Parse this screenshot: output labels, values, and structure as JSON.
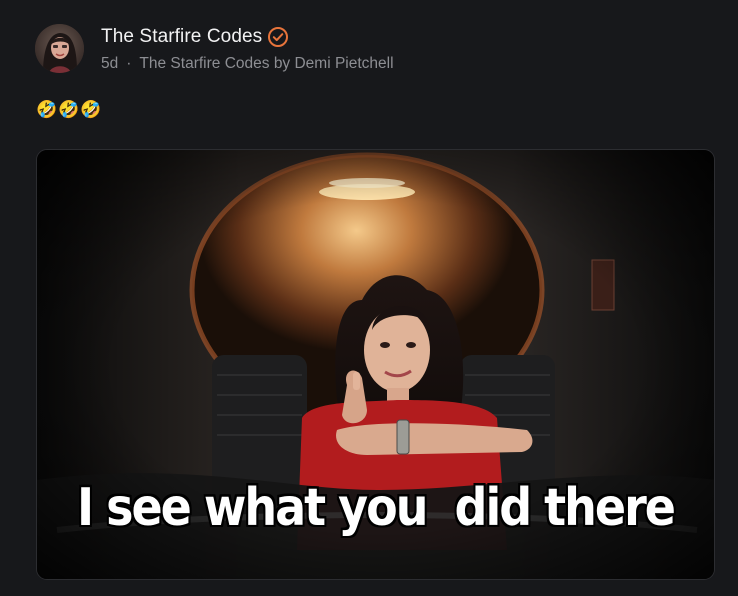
{
  "post": {
    "author_name": "The Starfire Codes",
    "verified_icon": "verified-check-icon",
    "time_ago": "5d",
    "separator": "·",
    "publication": "The Starfire Codes by Demi Pietchell",
    "body": "🤣🤣🤣",
    "media": {
      "caption": "I see what you  did there"
    }
  },
  "colors": {
    "background": "#17181b",
    "accent": "#e8743b",
    "muted_text": "#8d8e93"
  }
}
